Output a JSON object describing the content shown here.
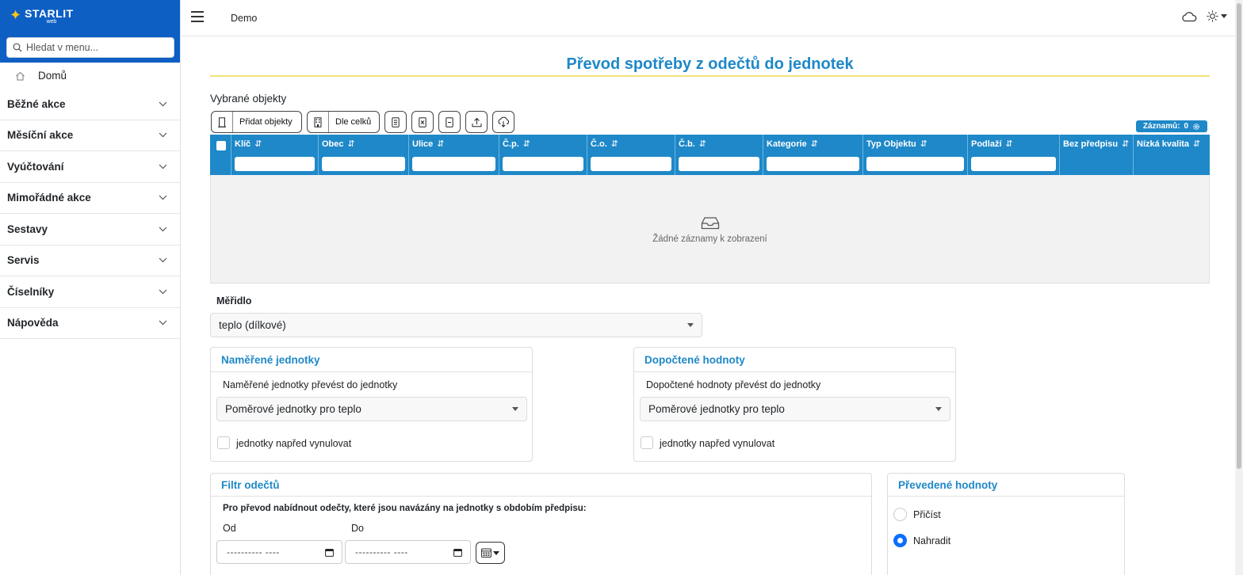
{
  "brand": {
    "name": "STARLIT",
    "sub": "web",
    "search_placeholder": "Hledat v menu..."
  },
  "sidebar": {
    "home_label": "Domů",
    "items": [
      {
        "label": "Běžné akce"
      },
      {
        "label": "Měsíční akce"
      },
      {
        "label": "Vyúčtování"
      },
      {
        "label": "Mimořádné akce"
      },
      {
        "label": "Sestavy"
      },
      {
        "label": "Servis"
      },
      {
        "label": "Číselníky"
      },
      {
        "label": "Nápověda"
      }
    ]
  },
  "topbar": {
    "breadcrumb": "Demo",
    "icons": [
      "menu-icon",
      "cloud-icon",
      "sun-icon"
    ]
  },
  "page": {
    "title": "Převod spotřeby z odečtů do jednotek",
    "selected_objects_label": "Vybrané objekty"
  },
  "toolbar": {
    "add_objects": "Přidat objekty",
    "by_whole": "Dle celků",
    "records_label": "Záznamů:",
    "records_count": "0"
  },
  "grid": {
    "columns": [
      {
        "label": "Klíč",
        "filter": true
      },
      {
        "label": "Obec",
        "filter": true
      },
      {
        "label": "Ulice",
        "filter": true
      },
      {
        "label": "Č.p.",
        "filter": true
      },
      {
        "label": "Č.o.",
        "filter": true
      },
      {
        "label": "Č.b.",
        "filter": true
      },
      {
        "label": "Kategorie",
        "filter": true
      },
      {
        "label": "Typ Objektu",
        "filter": true
      },
      {
        "label": "Podlaží",
        "filter": true
      },
      {
        "label": "Bez předpisu",
        "filter": false
      },
      {
        "label": "Nízká kvalita",
        "filter": false
      }
    ],
    "empty_text": "Žádné záznamy k zobrazení"
  },
  "meter": {
    "label": "Měřidlo",
    "value": "teplo (dílkové)"
  },
  "measured": {
    "title": "Naměřené jednotky",
    "sub_label": "Naměřené jednotky převést do jednotky",
    "select_value": "Poměrové jednotky pro teplo",
    "checkbox_label": "jednotky napřed vynulovat"
  },
  "computed": {
    "title": "Dopočtené hodnoty",
    "sub_label": "Dopočtené hodnoty převést do jednotky",
    "select_value": "Poměrové jednotky pro teplo",
    "checkbox_label": "jednotky napřed vynulovat"
  },
  "filter": {
    "title": "Filtr odečtů",
    "description": "Pro převod nabídnout odečty, které jsou navázány na jednotky s obdobím předpisu:",
    "from_label": "Od",
    "to_label": "Do",
    "from_value": "---------- ----",
    "to_value": "---------- ----"
  },
  "converted": {
    "title": "Převedené hodnoty",
    "options": [
      {
        "label": "Přičíst",
        "selected": false
      },
      {
        "label": "Nahradit",
        "selected": true
      }
    ]
  },
  "colors": {
    "brand": "#0d5fc4",
    "accent": "#1e88c8",
    "rule": "#f2e27a",
    "radio": "#0d6efd"
  }
}
